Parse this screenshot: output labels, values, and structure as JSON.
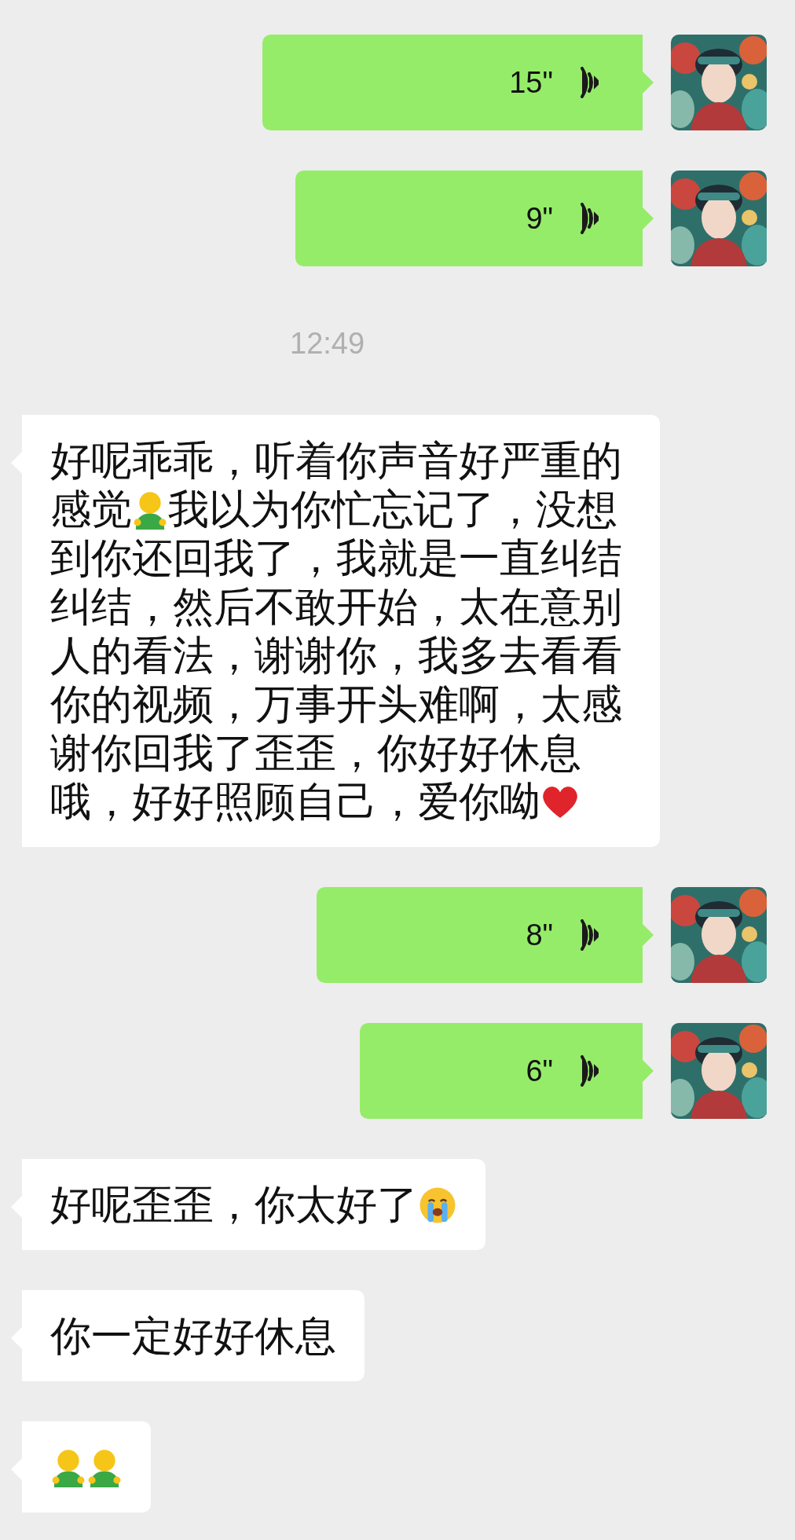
{
  "messages": [
    {
      "kind": "voice",
      "duration": "15\""
    },
    {
      "kind": "voice",
      "duration": "9\""
    },
    {
      "kind": "time",
      "time": "12:49"
    },
    {
      "kind": "text",
      "parts": [
        {
          "kind": "text",
          "text": "好呢乖乖，听着你声音好严重的感觉"
        },
        {
          "kind": "figure"
        },
        {
          "kind": "text",
          "text": "我以为你忙忘记了，没想到你还回我了，我就是一直纠结纠结，然后不敢开始，太在意别人的看法，谢谢你，我多去看看你的视频，万事开头难啊，太感谢你回我了歪歪，你好好休息哦，好好照顾自己，爱你呦"
        },
        {
          "kind": "heart"
        }
      ]
    },
    {
      "kind": "voice",
      "duration": "8\""
    },
    {
      "kind": "voice",
      "duration": "6\""
    },
    {
      "kind": "text",
      "parts": [
        {
          "kind": "text",
          "text": "好呢歪歪，你太好了"
        },
        {
          "kind": "crying"
        }
      ]
    },
    {
      "kind": "text",
      "parts": [
        {
          "kind": "text",
          "text": "你一定好好休息"
        }
      ]
    },
    {
      "kind": "text",
      "parts": [
        {
          "kind": "figure"
        },
        {
          "kind": "figure"
        }
      ]
    }
  ]
}
